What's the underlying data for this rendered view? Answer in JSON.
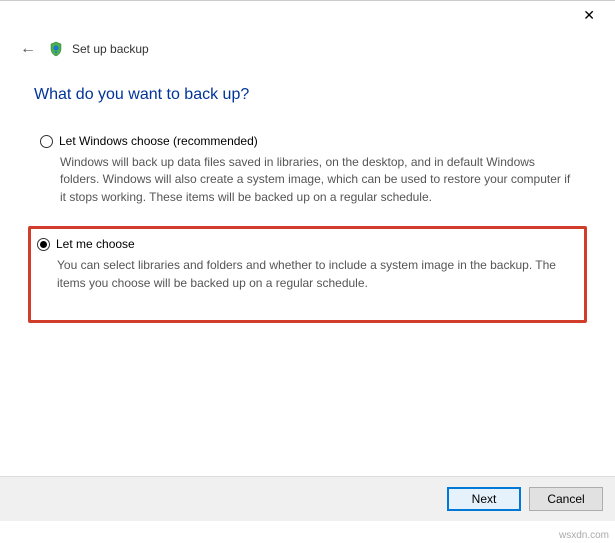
{
  "titlebar": {
    "close_icon": "✕"
  },
  "header": {
    "back_icon": "←",
    "window_title": "Set up backup"
  },
  "main": {
    "heading": "What do you want to back up?",
    "options": [
      {
        "label": "Let Windows choose (recommended)",
        "selected": false,
        "description": "Windows will back up data files saved in libraries, on the desktop, and in default Windows folders. Windows will also create a system image, which can be used to restore your computer if it stops working. These items will be backed up on a regular schedule."
      },
      {
        "label": "Let me choose",
        "selected": true,
        "description": "You can select libraries and folders and whether to include a system image in the backup. The items you choose will be backed up on a regular schedule."
      }
    ]
  },
  "footer": {
    "next_label": "Next",
    "cancel_label": "Cancel"
  },
  "watermark": "wsxdn.com"
}
